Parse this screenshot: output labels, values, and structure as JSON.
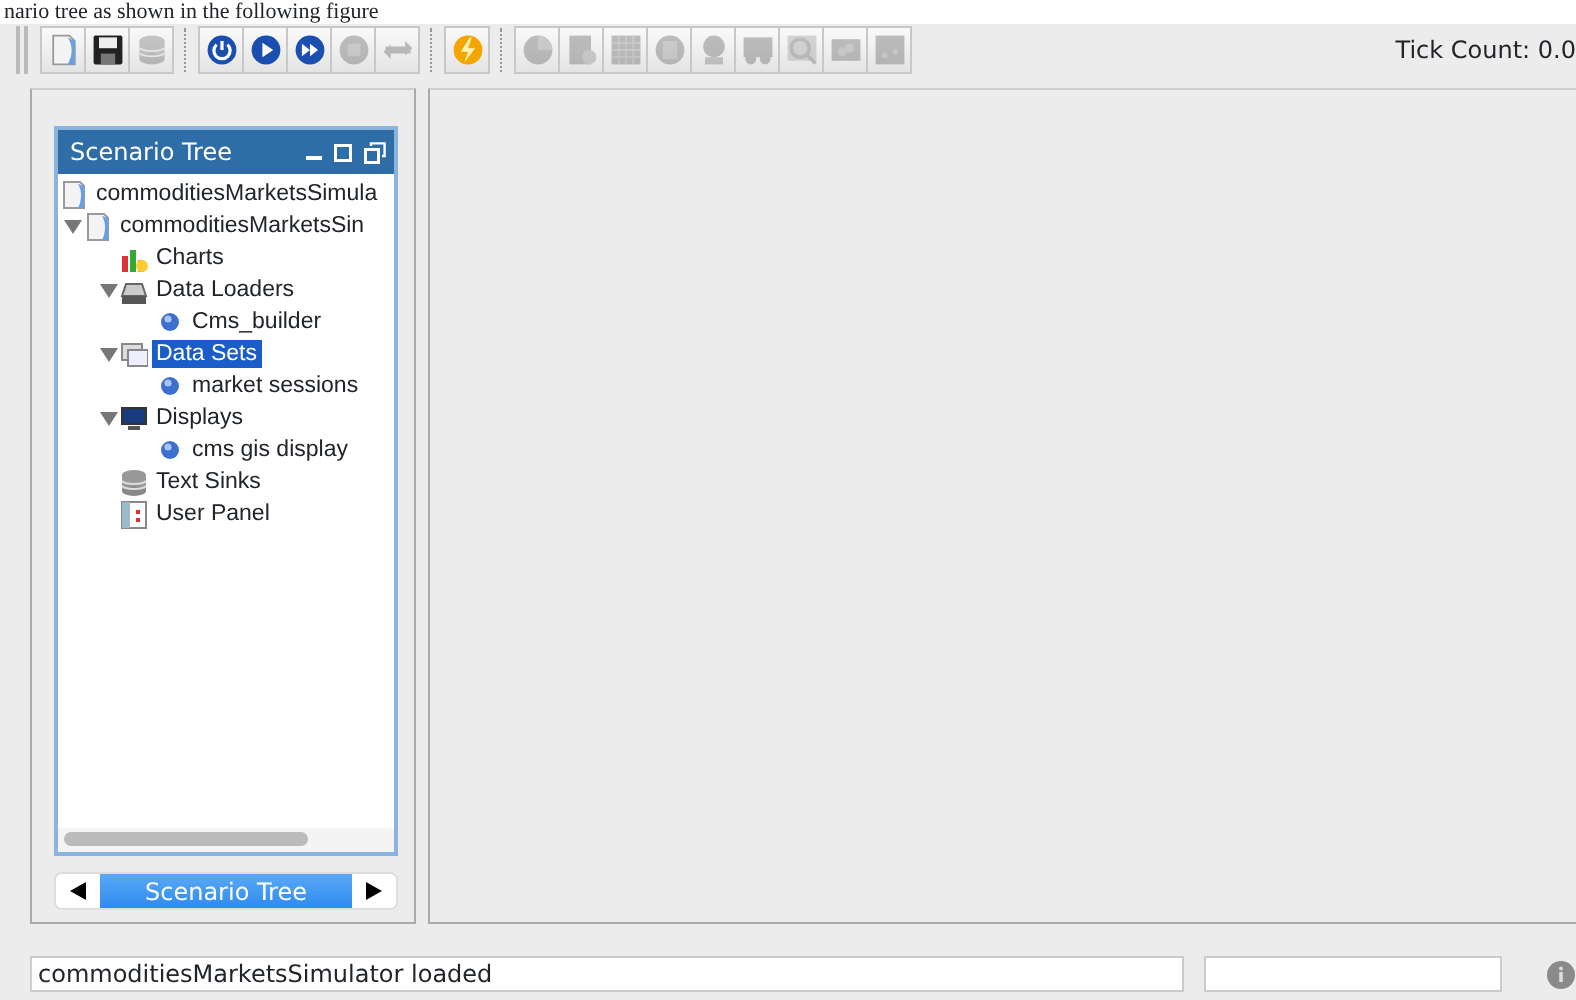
{
  "caption": "nario tree as shown in the following figure",
  "toolbar": {
    "groups": [
      [
        {
          "disabled": false
        },
        {
          "disabled": false
        },
        {
          "disabled": true
        }
      ],
      [
        {
          "disabled": false
        },
        {
          "disabled": false
        },
        {
          "disabled": false
        },
        {
          "disabled": true
        },
        {
          "disabled": true
        }
      ],
      [
        {
          "disabled": false
        }
      ],
      [
        {
          "disabled": true
        },
        {
          "disabled": true
        },
        {
          "disabled": true
        },
        {
          "disabled": true
        },
        {
          "disabled": true
        },
        {
          "disabled": true
        },
        {
          "disabled": true
        },
        {
          "disabled": true
        },
        {
          "disabled": true
        }
      ]
    ],
    "tick_count": "Tick Count: 0.0"
  },
  "scenario_panel": {
    "title": "Scenario Tree",
    "tree": [
      {
        "label": "commoditiesMarketsSimula",
        "kind": "scenario",
        "selected": false
      },
      {
        "label": "commoditiesMarketsSin",
        "kind": "scenario",
        "selected": false,
        "expanded": true,
        "children": [
          {
            "label": "Charts",
            "kind": "charts",
            "selected": false
          },
          {
            "label": "Data Loaders",
            "kind": "loaders",
            "selected": false,
            "expanded": true,
            "children": [
              {
                "label": "Cms_builder",
                "kind": "item",
                "selected": false
              }
            ]
          },
          {
            "label": "Data Sets",
            "kind": "datasets",
            "selected": true,
            "expanded": true,
            "children": [
              {
                "label": "market sessions",
                "kind": "item",
                "selected": false
              }
            ]
          },
          {
            "label": "Displays",
            "kind": "displays",
            "selected": false,
            "expanded": true,
            "children": [
              {
                "label": "cms gis display",
                "kind": "item",
                "selected": false
              }
            ]
          },
          {
            "label": "Text Sinks",
            "kind": "sinks",
            "selected": false
          },
          {
            "label": "User Panel",
            "kind": "panel",
            "selected": false
          }
        ]
      }
    ],
    "tabs": [
      {
        "label": "Scenario Tree",
        "selected": true
      }
    ]
  },
  "status_bar": {
    "message": "commoditiesMarketsSimulator loaded"
  }
}
